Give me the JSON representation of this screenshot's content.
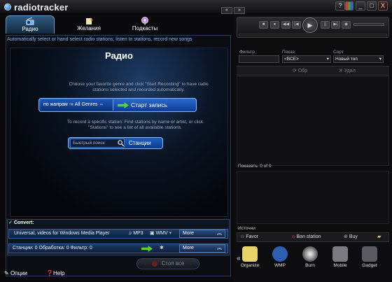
{
  "app": {
    "title": "radiotracker"
  },
  "titlebar": {
    "help": "?",
    "min": "_",
    "max": "□",
    "close": "X",
    "back": "«",
    "forward": "»"
  },
  "tabs": [
    {
      "label": "Радио",
      "icon": "radio-icon"
    },
    {
      "label": "Желания",
      "icon": "wish-icon"
    },
    {
      "label": "Подкасты",
      "icon": "podcast-icon"
    }
  ],
  "info_line": "Automatically select or hand select radio stations, listen to stations, record new songs",
  "radio": {
    "title": "Радио",
    "desc1": "Choose your favorite genre and click \"Start Recording\" to have radio stations selected and recorded automatically.",
    "genre_select": "по жанрам -» All Genres ⇔",
    "start_button": "Старт запись",
    "desc2": "To record a specific station: Find stations by name or artist, or click \"Stations\" to see a list of all available stations.",
    "search_placeholder": "Быстрый поиск",
    "stations_button": "Станции"
  },
  "convert": {
    "label": "Convert:",
    "profile": "Universal, videos for Windows Media Player",
    "fmt_audio": "MP3",
    "fmt_video": "WMV",
    "more1": "More",
    "stats": "Станции: 0   Обработка: 0   Фильтр: 0",
    "more2": "More"
  },
  "stop_all": "Стоп все",
  "footer": {
    "options": "Опции",
    "help": "Help"
  },
  "player": {
    "play_symbol": "▶"
  },
  "filters": {
    "filter_label": "Фильтр",
    "show_label": "Показ",
    "sort_label": "Сорт",
    "show_value": "<ВСЕ>",
    "sort_value": "Новый топ",
    "obr_label": "Обр",
    "del_label": "Удал"
  },
  "show_count": "Показать: 0 of 0",
  "sources_label": "Источни",
  "sources_row": {
    "favor": "Favor",
    "ban": "Ban station",
    "buy": "Buy"
  },
  "dock": [
    {
      "label": "Organize",
      "icon": "organize-icon",
      "color": "#e8d36b"
    },
    {
      "label": "WMP",
      "icon": "wmp-icon",
      "color": "#2c5fb0"
    },
    {
      "label": "Burn",
      "icon": "burn-icon",
      "color": "#9a9aa0"
    },
    {
      "label": "Mobile",
      "icon": "mobile-icon",
      "color": "#7a7a80"
    },
    {
      "label": "Gadget",
      "icon": "gadget-icon",
      "color": "#5a5a60"
    }
  ]
}
